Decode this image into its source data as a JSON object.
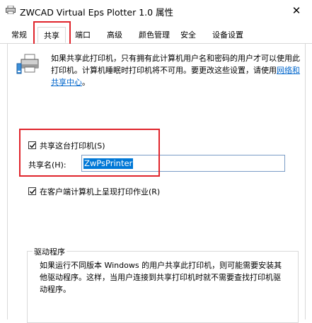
{
  "window": {
    "title": "ZWCAD Virtual Eps Plotter 1.0 属性",
    "close_glyph": "✕"
  },
  "tabs": [
    {
      "label": "常规"
    },
    {
      "label": "共享"
    },
    {
      "label": "端口"
    },
    {
      "label": "高级"
    },
    {
      "label": "颜色管理"
    },
    {
      "label": "安全"
    },
    {
      "label": "设备设置"
    }
  ],
  "active_tab": "共享",
  "sharing": {
    "description_text": "如果共享此打印机，只有拥有此计算机用户名和密码的用户才可以使用此打印机。计算机睡眠时打印机将不可用。要更改这些设置，请使用",
    "description_link": "网络和共享中心",
    "description_end": "。",
    "share_checkbox_label": "共享这台打印机(S)",
    "share_checked": true,
    "share_name_label": "共享名(H):",
    "share_name_value": "ZwPsPrinter",
    "render_checkbox_label": "在客户端计算机上呈现打印作业(R)",
    "render_checked": true
  },
  "drivers": {
    "group_title": "驱动程序",
    "text": "如果运行不同版本 Windows 的用户共享此打印机，则可能需要安装其他驱动程序。这样，当用户连接到共享打印机时就不需要查找打印机驱动程序。"
  },
  "colors": {
    "highlight": "#e0242b",
    "link": "#0066cc",
    "selection": "#0078d7"
  }
}
